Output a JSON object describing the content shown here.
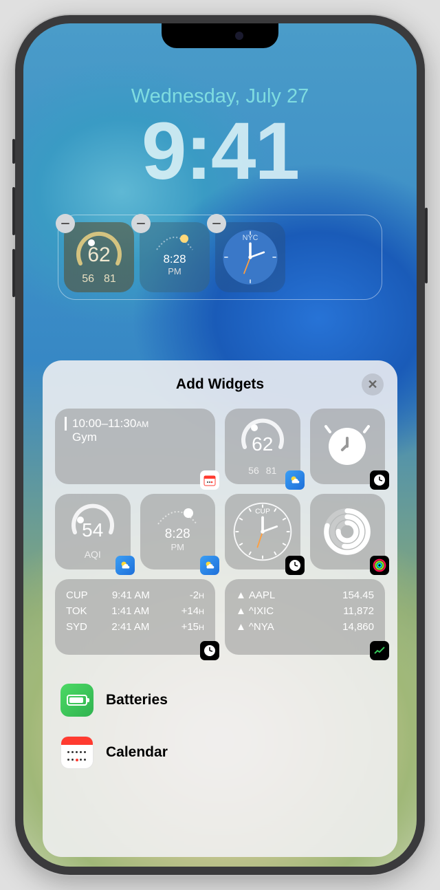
{
  "lockscreen": {
    "date": "Wednesday, July 27",
    "time": "9:41"
  },
  "widget_slots": [
    {
      "type": "weather-gauge",
      "value": "62",
      "low": "56",
      "high": "81"
    },
    {
      "type": "sunset",
      "time": "8:28",
      "ampm": "PM"
    },
    {
      "type": "world-clock-analog",
      "city": "NYC"
    }
  ],
  "sheet": {
    "title": "Add Widgets",
    "previews": {
      "calendar": {
        "time_range": "10:00–11:30",
        "ampm": "AM",
        "title": "Gym"
      },
      "weather_gauge": {
        "value": "62",
        "low": "56",
        "high": "81"
      },
      "aqi": {
        "value": "54",
        "label": "AQI"
      },
      "sunset": {
        "time": "8:28",
        "ampm": "PM"
      },
      "analog_clock": {
        "city": "CUP"
      },
      "world_clock": {
        "rows": [
          {
            "city": "CUP",
            "time": "9:41 AM",
            "offset": "-2",
            "unit": "H"
          },
          {
            "city": "TOK",
            "time": "1:41 AM",
            "offset": "+14",
            "unit": "H"
          },
          {
            "city": "SYD",
            "time": "2:41 AM",
            "offset": "+15",
            "unit": "H"
          }
        ]
      },
      "stocks": {
        "rows": [
          {
            "symbol": "AAPL",
            "value": "154.45"
          },
          {
            "symbol": "^IXIC",
            "value": "11,872"
          },
          {
            "symbol": "^NYA",
            "value": "14,860"
          }
        ]
      }
    },
    "apps": [
      {
        "name": "Batteries"
      },
      {
        "name": "Calendar"
      }
    ]
  }
}
